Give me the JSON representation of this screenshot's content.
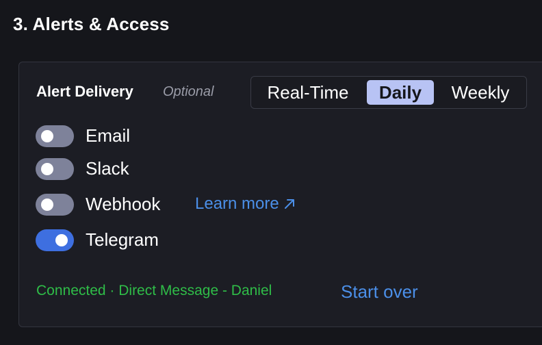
{
  "section": {
    "title": "3. Alerts & Access"
  },
  "alert_delivery": {
    "title": "Alert Delivery",
    "optional_label": "Optional",
    "frequency": {
      "options": [
        "Real-Time",
        "Daily",
        "Weekly"
      ],
      "selected": "Daily"
    },
    "channels": [
      {
        "label": "Email",
        "enabled": false
      },
      {
        "label": "Slack",
        "enabled": false
      },
      {
        "label": "Webhook",
        "enabled": false,
        "link_label": "Learn more"
      },
      {
        "label": "Telegram",
        "enabled": true
      }
    ],
    "status_text": "Connected · Direct Message - Daniel",
    "start_over_label": "Start over"
  },
  "colors": {
    "accent_blue": "#3e6fe0",
    "link_blue": "#4b8fe8",
    "status_green": "#2fbd48",
    "selected_segment": "#b8c3f4"
  },
  "icons": {
    "learn_more": "external-link-arrow-icon"
  }
}
